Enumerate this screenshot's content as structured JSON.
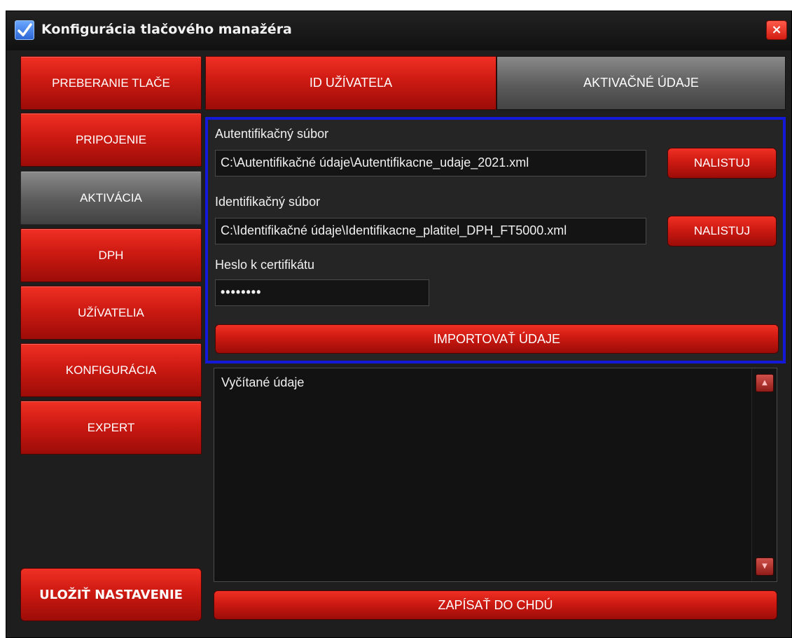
{
  "window": {
    "title": "Konfigurácia tlačového manažéra",
    "close_label": "×"
  },
  "sidebar": {
    "items": [
      {
        "label": "PREBERANIE TLAČE"
      },
      {
        "label": "PRIPOJENIE"
      },
      {
        "label": "AKTIVÁCIA"
      },
      {
        "label": "DPH"
      },
      {
        "label": "UŽÍVATELIA"
      },
      {
        "label": "KONFIGURÁCIA"
      },
      {
        "label": "EXPERT"
      }
    ],
    "active_item": "AKTIVÁCIA",
    "save_label": "ULOŽIŤ NASTAVENIE"
  },
  "tabs": [
    {
      "label": "ID UŽÍVATEĽA"
    },
    {
      "label": "AKTIVAČNÉ ÚDAJE"
    }
  ],
  "form": {
    "auth_label": "Autentifikačný súbor",
    "auth_value": "C:\\Autentifikačné údaje\\Autentifikacne_udaje_2021.xml",
    "browse_label": "NALISTUJ",
    "id_label": "Identifikačný súbor",
    "id_value": "C:\\Identifikačné údaje\\Identifikacne_platitel_DPH_FT5000.xml",
    "password_label": "Heslo k certifikátu",
    "password_value": "••••••••",
    "import_label": "IMPORTOVAŤ ÚDAJE"
  },
  "output": {
    "text": "Vyčítané údaje"
  },
  "footer": {
    "write_label": "ZAPÍSAŤ DO CHDÚ"
  },
  "colors": {
    "accent_red": "#cd1a12",
    "active_gray": "#5b5b5b",
    "highlight_blue": "#1418d8"
  }
}
